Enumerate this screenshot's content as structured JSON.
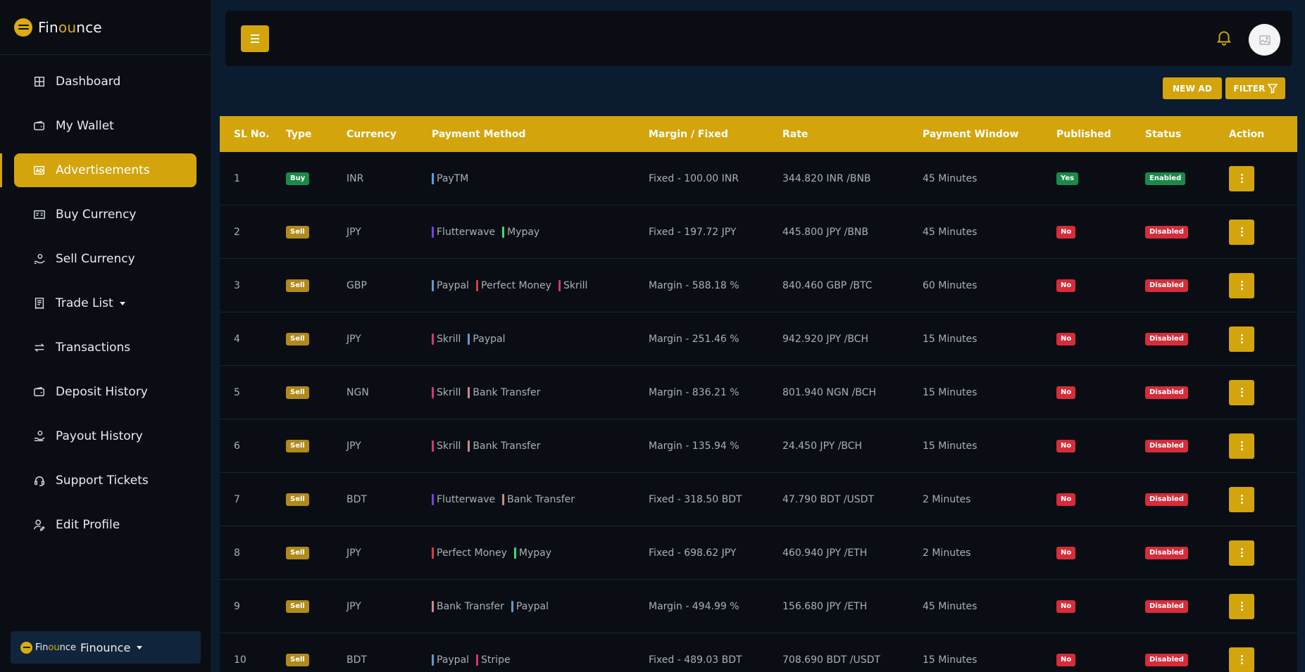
{
  "brand": {
    "prefix": "Fin",
    "highlight": "ou",
    "suffix": "nce"
  },
  "sidebar": {
    "items": [
      {
        "label": "Dashboard",
        "icon": "grid-icon",
        "active": false
      },
      {
        "label": "My Wallet",
        "icon": "wallet-icon",
        "active": false
      },
      {
        "label": "Advertisements",
        "icon": "ad-icon",
        "active": true
      },
      {
        "label": "Buy Currency",
        "icon": "card-icon",
        "active": false
      },
      {
        "label": "Sell Currency",
        "icon": "hand-coin-icon",
        "active": false
      },
      {
        "label": "Trade List",
        "icon": "receipt-icon",
        "active": false,
        "dropdown": true
      },
      {
        "label": "Transactions",
        "icon": "exchange-icon",
        "active": false
      },
      {
        "label": "Deposit History",
        "icon": "wallet-icon",
        "active": false
      },
      {
        "label": "Payout History",
        "icon": "payout-icon",
        "active": false
      },
      {
        "label": "Support Tickets",
        "icon": "headset-icon",
        "active": false
      },
      {
        "label": "Edit Profile",
        "icon": "user-edit-icon",
        "active": false
      }
    ],
    "profile_switch": {
      "brand_prefix": "Fin",
      "brand_highlight": "ou",
      "brand_suffix": "nce",
      "name": "Finounce"
    }
  },
  "toolbar": {
    "new_ad_label": "NEW AD",
    "filter_label": "FILTER"
  },
  "table": {
    "headers": [
      "SL No.",
      "Type",
      "Currency",
      "Payment Method",
      "Margin / Fixed",
      "Rate",
      "Payment Window",
      "Published",
      "Status",
      "Action"
    ],
    "rows": [
      {
        "sl": "1",
        "type": "Buy",
        "currency": "INR",
        "methods": [
          {
            "name": "PayTM",
            "color": "#4da3ff"
          }
        ],
        "margin": "Fixed - 100.00 INR",
        "rate": "344.820 INR /BNB",
        "window": "45 Minutes",
        "published": "Yes",
        "status": "Enabled"
      },
      {
        "sl": "2",
        "type": "Sell",
        "currency": "JPY",
        "methods": [
          {
            "name": "Flutterwave",
            "color": "#7b3fe4"
          },
          {
            "name": "Mypay",
            "color": "#3ddc6a"
          }
        ],
        "margin": "Fixed - 197.72 JPY",
        "rate": "445.800 JPY /BNB",
        "window": "45 Minutes",
        "published": "No",
        "status": "Disabled"
      },
      {
        "sl": "3",
        "type": "Sell",
        "currency": "GBP",
        "methods": [
          {
            "name": "Paypal",
            "color": "#5b9bd5"
          },
          {
            "name": "Perfect Money",
            "color": "#e03a3a"
          },
          {
            "name": "Skrill",
            "color": "#d63384"
          }
        ],
        "margin": "Margin - 588.18 %",
        "rate": "840.460 GBP /BTC",
        "window": "60 Minutes",
        "published": "No",
        "status": "Disabled"
      },
      {
        "sl": "4",
        "type": "Sell",
        "currency": "JPY",
        "methods": [
          {
            "name": "Skrill",
            "color": "#d63384"
          },
          {
            "name": "Paypal",
            "color": "#5b9bd5"
          }
        ],
        "margin": "Margin - 251.46 %",
        "rate": "942.920 JPY /BCH",
        "window": "15 Minutes",
        "published": "No",
        "status": "Disabled"
      },
      {
        "sl": "5",
        "type": "Sell",
        "currency": "NGN",
        "methods": [
          {
            "name": "Skrill",
            "color": "#d63384"
          },
          {
            "name": "Bank Transfer",
            "color": "#c98b8b"
          }
        ],
        "margin": "Margin - 836.21 %",
        "rate": "801.940 NGN /BCH",
        "window": "15 Minutes",
        "published": "No",
        "status": "Disabled"
      },
      {
        "sl": "6",
        "type": "Sell",
        "currency": "JPY",
        "methods": [
          {
            "name": "Skrill",
            "color": "#d63384"
          },
          {
            "name": "Bank Transfer",
            "color": "#c98b8b"
          }
        ],
        "margin": "Margin - 135.94 %",
        "rate": "24.450 JPY /BCH",
        "window": "15 Minutes",
        "published": "No",
        "status": "Disabled"
      },
      {
        "sl": "7",
        "type": "Sell",
        "currency": "BDT",
        "methods": [
          {
            "name": "Flutterwave",
            "color": "#7b3fe4"
          },
          {
            "name": "Bank Transfer",
            "color": "#c98b8b"
          }
        ],
        "margin": "Fixed - 318.50 BDT",
        "rate": "47.790 BDT /USDT",
        "window": "2 Minutes",
        "published": "No",
        "status": "Disabled"
      },
      {
        "sl": "8",
        "type": "Sell",
        "currency": "JPY",
        "methods": [
          {
            "name": "Perfect Money",
            "color": "#e03a3a"
          },
          {
            "name": "Mypay",
            "color": "#3ddc6a"
          }
        ],
        "margin": "Fixed - 698.62 JPY",
        "rate": "460.940 JPY /ETH",
        "window": "2 Minutes",
        "published": "No",
        "status": "Disabled"
      },
      {
        "sl": "9",
        "type": "Sell",
        "currency": "JPY",
        "methods": [
          {
            "name": "Bank Transfer",
            "color": "#c98b8b"
          },
          {
            "name": "Paypal",
            "color": "#5b9bd5"
          }
        ],
        "margin": "Margin - 494.99 %",
        "rate": "156.680 JPY /ETH",
        "window": "45 Minutes",
        "published": "No",
        "status": "Disabled"
      },
      {
        "sl": "10",
        "type": "Sell",
        "currency": "BDT",
        "methods": [
          {
            "name": "Paypal",
            "color": "#5b9bd5"
          },
          {
            "name": "Stripe",
            "color": "#d63384"
          }
        ],
        "margin": "Fixed - 489.03 BDT",
        "rate": "708.690 BDT /USDT",
        "window": "15 Minutes",
        "published": "No",
        "status": "Disabled"
      }
    ]
  },
  "colors": {
    "accent": "#d4a40d",
    "success": "#1a8a4a",
    "danger": "#d62c3b",
    "sidebar_bg": "#0a0e14",
    "page_bg": "#0b1c30"
  }
}
